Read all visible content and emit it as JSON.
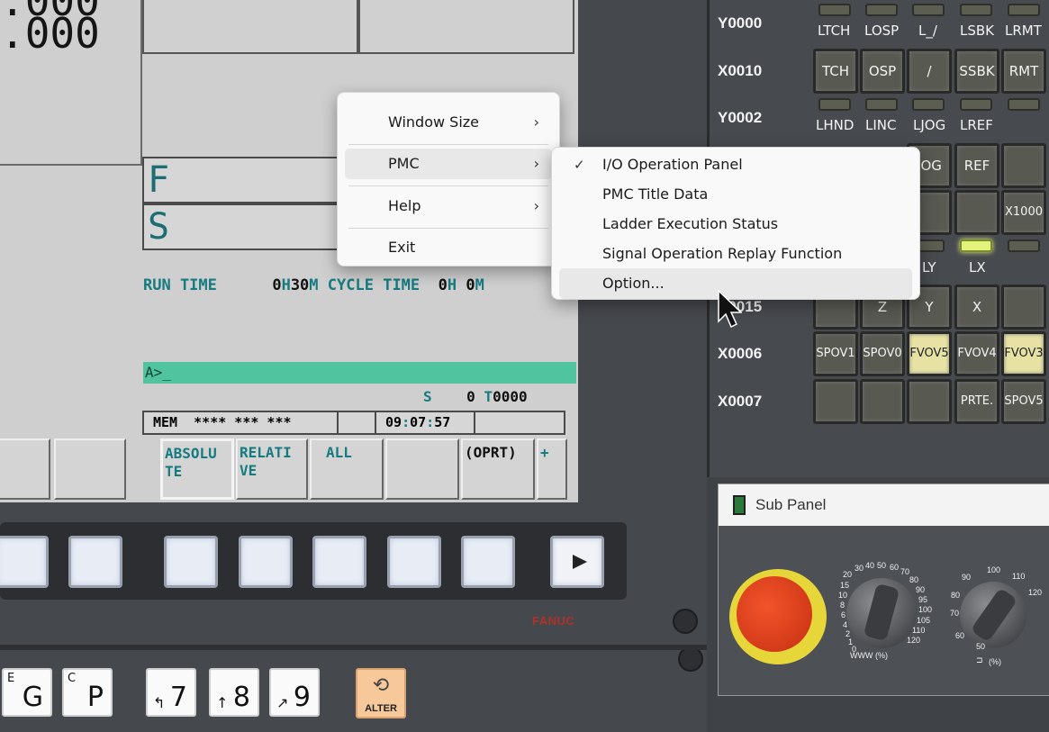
{
  "screen": {
    "coord1": ".000",
    "coord2": ".000",
    "f_label": "F",
    "s_label": "S",
    "run_time_label": "RUN TIME",
    "run_time_h": "0",
    "run_time_h_unit": "H",
    "run_time_m": "30",
    "run_time_m_unit": "M",
    "cycle_time_label": "CYCLE TIME",
    "cycle_time_h": "0",
    "cycle_time_h_unit": "H",
    "cycle_time_m": "0",
    "cycle_time_m_unit": "M",
    "command_prompt": "A>_",
    "spindle_label": "S",
    "spindle_value": "0",
    "tool_label": "T",
    "tool_value": "0000",
    "mode": "MEM",
    "status_stars": "**** *** ***",
    "clock_h": "09",
    "clock_m": "07",
    "clock_s": "57",
    "softkeys": [
      "ABSOLU TE",
      "RELATI VE",
      "ALL",
      "",
      "(OPRT)",
      "+"
    ],
    "softkey_absolute_1": "ABSOLU",
    "softkey_absolute_2": "TE",
    "softkey_relative_1": "RELATI",
    "softkey_relative_2": "VE",
    "softkey_all": "ALL",
    "softkey_oprt": "(OPRT)",
    "softkey_plus": "+",
    "brand": "FANUC",
    "next_arrow_icon": "play-arrow-icon"
  },
  "keyboard": {
    "keys": [
      {
        "sup": "E",
        "main": "G"
      },
      {
        "sup": "C",
        "main": "P"
      },
      {
        "arrow": "↰",
        "main": "7"
      },
      {
        "arrow": "↑",
        "main": "8"
      },
      {
        "arrow": "↗",
        "main": "9"
      }
    ],
    "alter_label": "ALTER"
  },
  "operator_panel": {
    "rows": [
      {
        "label": "Y0000"
      },
      {
        "label": "X0010"
      },
      {
        "label": "Y0002"
      },
      {
        "label": "X0015"
      },
      {
        "label": "X0006"
      },
      {
        "label": "X0007"
      }
    ],
    "row0_leds": [
      "LTCH",
      "LOSP",
      "L_/",
      "LSBK",
      "LRMT"
    ],
    "row1_buttons": [
      "TCH",
      "OSP",
      "/",
      "SSBK",
      "RMT"
    ],
    "row2_leds": [
      "LHND",
      "LINC",
      "LJOG",
      "LREF"
    ],
    "row3_buttons": [
      "JOG",
      "REF",
      ""
    ],
    "row4_buttons": [
      "",
      "X1000"
    ],
    "row5_leds": [
      "LY",
      "LX"
    ],
    "row6_buttons": [
      "Z",
      "Y",
      "X"
    ],
    "row7_buttons": [
      "SPOV1",
      "SPOV0",
      "FVOV5",
      "FVOV4",
      "FVOV3"
    ],
    "row8_buttons": [
      "PRTE.",
      "SPOV5"
    ],
    "led_on_color": "#e2f27a",
    "highlight_color": "#e7e2a4"
  },
  "sub_panel": {
    "title": "Sub Panel",
    "icon": "calculator-icon",
    "dial1_scale": [
      "20",
      "30",
      "40",
      "50",
      "60",
      "70",
      "80",
      "90",
      "95",
      "100",
      "105",
      "110",
      "120",
      "15",
      "10",
      "8",
      "6",
      "4",
      "2",
      "1",
      "0"
    ],
    "dial1_unit": "WWW (%)",
    "dial2_scale": [
      "50",
      "60",
      "70",
      "80",
      "90",
      "100",
      "110",
      "120"
    ],
    "dial2_unit": "(%)"
  },
  "context_menu": {
    "items": [
      {
        "label": "Window Size",
        "submenu": true
      },
      {
        "label": "PMC",
        "submenu": true,
        "active": true
      },
      {
        "label": "Help",
        "submenu": true
      },
      {
        "label": "Exit",
        "submenu": false
      }
    ]
  },
  "pmc_submenu": {
    "items": [
      {
        "label": "I/O Operation Panel",
        "checked": true
      },
      {
        "label": "PMC Title Data",
        "checked": false
      },
      {
        "label": "Ladder Execution Status",
        "checked": false
      },
      {
        "label": "Signal Operation Replay Function",
        "checked": false
      },
      {
        "label": "Option...",
        "checked": false,
        "hovered": true
      }
    ]
  }
}
